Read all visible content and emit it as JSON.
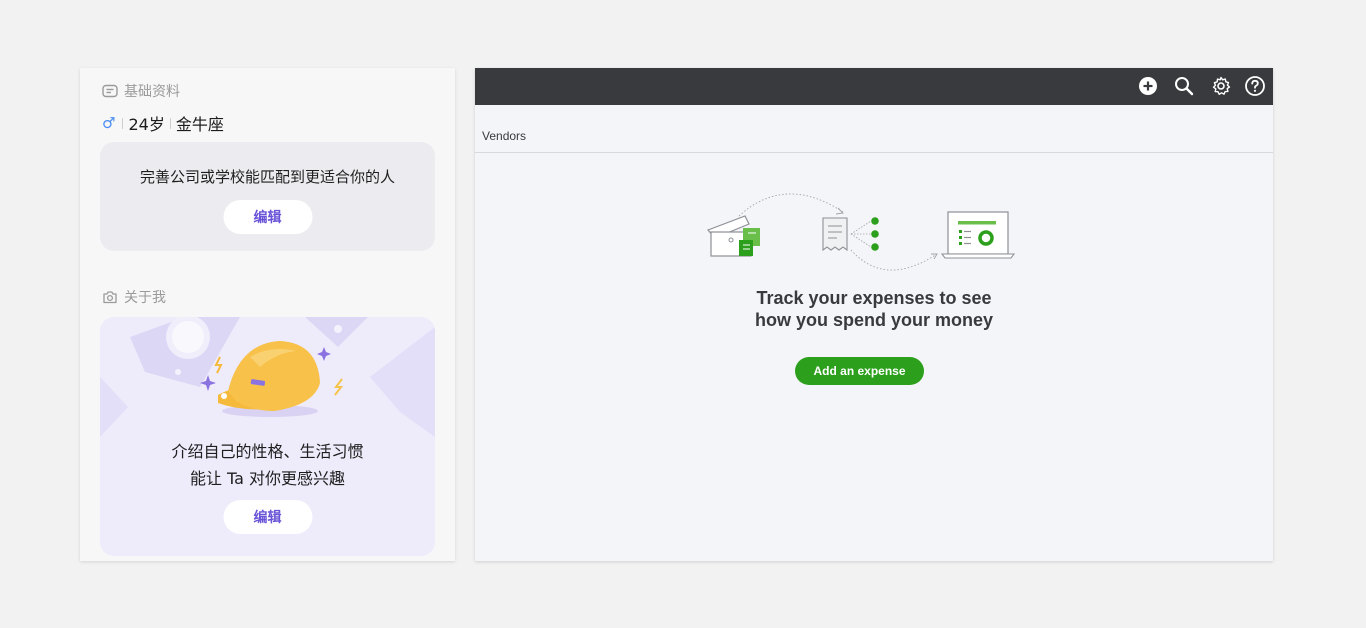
{
  "profile": {
    "basic_section_title": "基础资料",
    "gender_symbol": "♂",
    "age": "24岁",
    "zodiac": "金牛座",
    "company_card": {
      "text": "完善公司或学校能匹配到更适合你的人",
      "edit_label": "编辑"
    },
    "about_section_title": "关于我",
    "about_card": {
      "line1": "介绍自己的性格、生活习惯",
      "line2": "能让 Ta 对你更感兴趣",
      "edit_label": "编辑"
    }
  },
  "vendors_page": {
    "topbar_icons": [
      "add-icon",
      "search-icon",
      "gear-icon",
      "help-icon"
    ],
    "title": "Vendors",
    "headline_line1": "Track your expenses to see",
    "headline_line2": "how you spend your money",
    "add_expense_label": "Add an expense"
  },
  "colors": {
    "topbar": "#393a3d",
    "accent_green": "#2ca01c",
    "edit_purple": "#6a55d8",
    "gender_blue": "#4a8df0"
  }
}
